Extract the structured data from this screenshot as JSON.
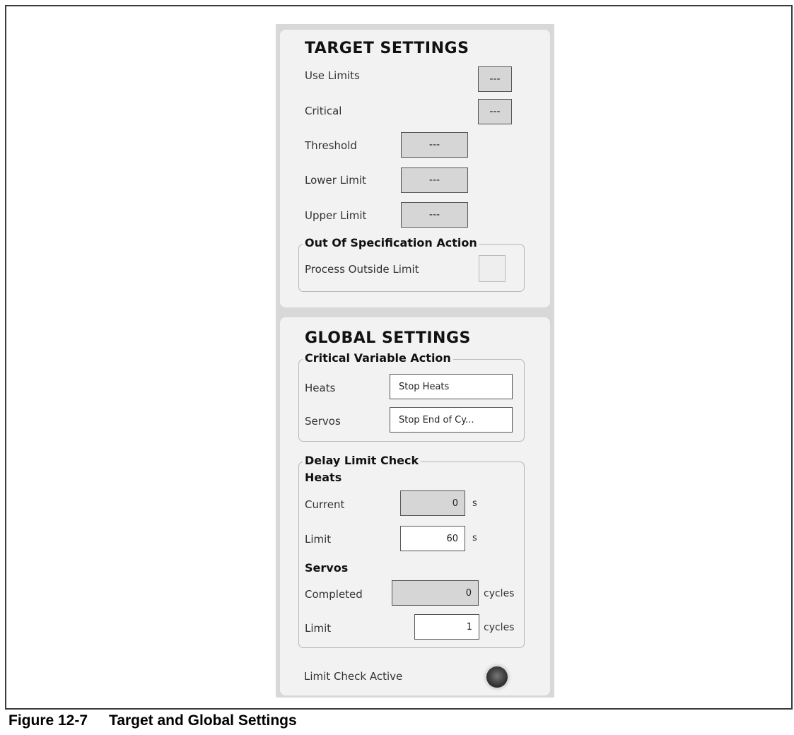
{
  "target_settings": {
    "title": "TARGET SETTINGS",
    "use_limits_label": "Use Limits",
    "use_limits_value": "---",
    "critical_label": "Critical",
    "critical_value": "---",
    "threshold_label": "Threshold",
    "threshold_value": "---",
    "lower_limit_label": "Lower Limit",
    "lower_limit_value": "---",
    "upper_limit_label": "Upper Limit",
    "upper_limit_value": "---",
    "oos_group_title": "Out Of Specification Action",
    "process_outside_limit_label": "Process Outside Limit",
    "process_outside_limit_value": ""
  },
  "global_settings": {
    "title": "GLOBAL SETTINGS",
    "critical_group_title": "Critical Variable Action",
    "heats_label": "Heats",
    "heats_action": "Stop Heats",
    "servos_label": "Servos",
    "servos_action": "Stop End of Cy...",
    "delay_group_title": "Delay Limit Check",
    "heats_section": "Heats",
    "current_label": "Current",
    "current_value": "0",
    "current_unit": "s",
    "heats_limit_label": "Limit",
    "heats_limit_value": "60",
    "heats_limit_unit": "s",
    "servos_section": "Servos",
    "completed_label": "Completed",
    "completed_value": "0",
    "completed_unit": "cycles",
    "servos_limit_label": "Limit",
    "servos_limit_value": "1",
    "servos_limit_unit": "cycles",
    "limit_check_active_label": "Limit Check Active",
    "limit_check_active_state": "off"
  },
  "caption": {
    "number": "Figure 12-7",
    "title": "Target and Global Settings"
  }
}
